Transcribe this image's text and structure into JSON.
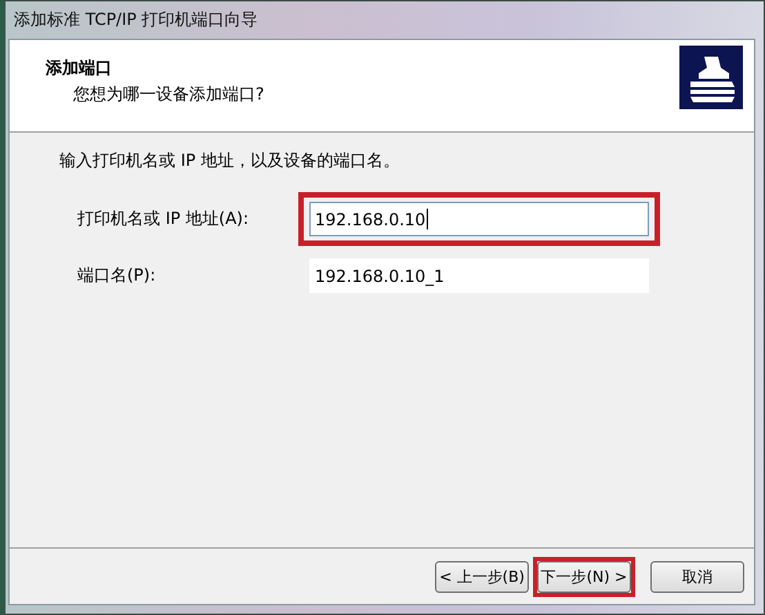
{
  "window": {
    "title": "添加标准 TCP/IP 打印机端口向导"
  },
  "header": {
    "title": "添加端口",
    "subtitle": "您想为哪一设备添加端口?"
  },
  "instruction": "输入打印机名或 IP 地址，以及设备的端口名。",
  "fields": [
    {
      "label": "打印机名或 IP 地址(A):",
      "value": "192.168.0.10",
      "focused": true,
      "highlighted": true
    },
    {
      "label": "端口名(P):",
      "value": "192.168.0.10_1",
      "focused": false,
      "highlighted": false
    }
  ],
  "buttons": [
    {
      "label": "< 上一步(B)",
      "highlighted": false
    },
    {
      "label": "下一步(N) >",
      "highlighted": true
    },
    {
      "label": "取消",
      "highlighted": false
    }
  ]
}
